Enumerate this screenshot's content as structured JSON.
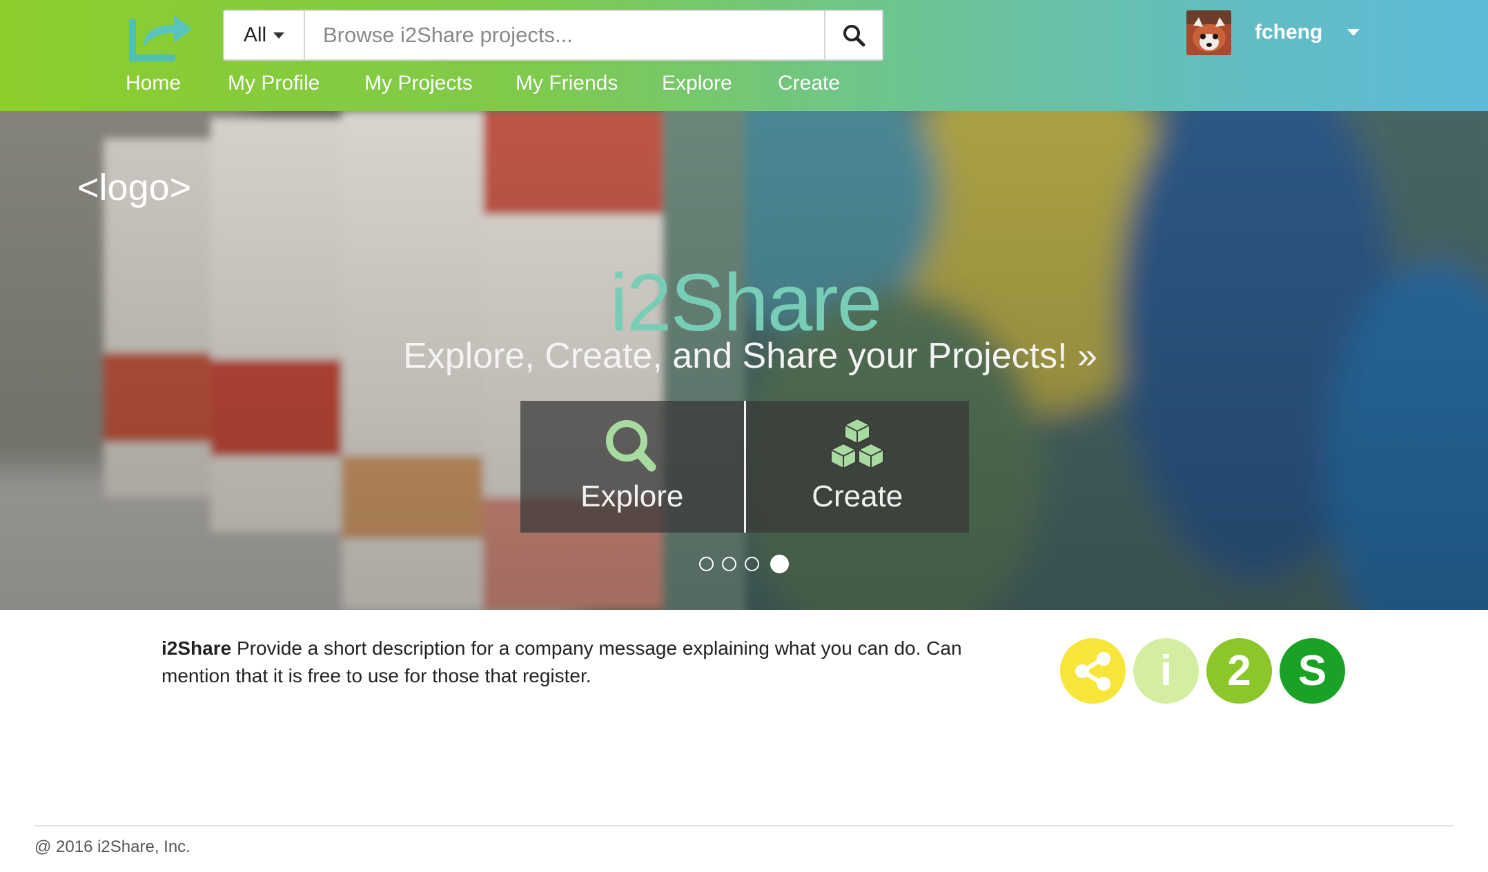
{
  "header": {
    "search": {
      "scope_label": "All",
      "placeholder": "Browse i2Share projects..."
    },
    "nav": [
      {
        "label": "Home"
      },
      {
        "label": "My Profile"
      },
      {
        "label": "My Projects"
      },
      {
        "label": "My Friends"
      },
      {
        "label": "Explore"
      },
      {
        "label": "Create"
      }
    ],
    "user": {
      "name": "fcheng"
    }
  },
  "hero": {
    "placeholder_logo": "<logo>",
    "title": "i2Share",
    "tagline": "Explore, Create, and Share your Projects! »",
    "actions": [
      {
        "label": "Explore",
        "icon": "search-icon"
      },
      {
        "label": "Create",
        "icon": "cubes-icon"
      }
    ],
    "carousel": {
      "slides": 4,
      "active": 4
    }
  },
  "intro": {
    "brand": "i2Share",
    "text": " Provide a short description for a company message explaining what you can do. Can mention that it is free to use for those that register."
  },
  "badges": [
    {
      "glyph": "",
      "icon": "share-icon",
      "color": "#f8e53a"
    },
    {
      "glyph": "i",
      "color": "#d3eea0"
    },
    {
      "glyph": "2",
      "color": "#8cc629"
    },
    {
      "glyph": "S",
      "color": "#19a226"
    }
  ],
  "footer": {
    "copyright": "@ 2016 i2Share, Inc."
  },
  "colors": {
    "header_gradient_start": "#8cce2c",
    "header_gradient_end": "#5ebbd8",
    "hero_title": "#78cdb6",
    "action_icon": "#a8dba0"
  }
}
